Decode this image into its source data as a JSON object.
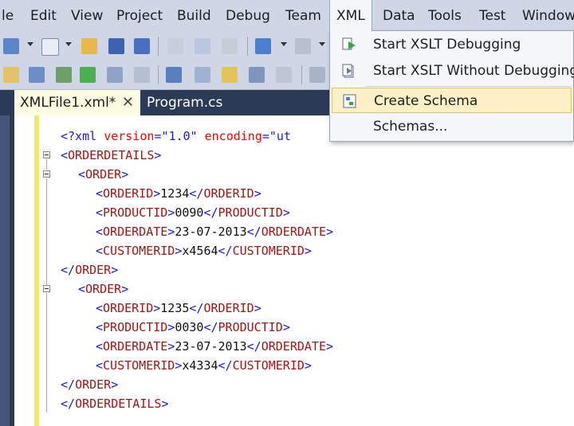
{
  "menubar": {
    "items": [
      {
        "label": "le"
      },
      {
        "label": "Edit"
      },
      {
        "label": "View"
      },
      {
        "label": "Project"
      },
      {
        "label": "Build"
      },
      {
        "label": "Debug"
      },
      {
        "label": "Team"
      },
      {
        "label": "XML"
      },
      {
        "label": "Data"
      },
      {
        "label": "Tools"
      },
      {
        "label": "Test"
      },
      {
        "label": "Window"
      }
    ]
  },
  "xml_menu": {
    "items": [
      {
        "label": "Start XSLT Debugging",
        "icon": "start-debugging-icon"
      },
      {
        "label": "Start XSLT Without Debugging",
        "icon": "start-without-debugging-icon"
      },
      {
        "label": "Create Schema",
        "icon": "create-schema-icon",
        "highlighted": true
      },
      {
        "label": "Schemas...",
        "icon": ""
      }
    ]
  },
  "tabs": [
    {
      "label": "XMLFile1.xml*",
      "active": true,
      "close": "✕"
    },
    {
      "label": "Program.cs",
      "active": false
    }
  ],
  "editor": {
    "declaration": {
      "open": "<?xml ",
      "attr1": "version",
      "eq": "=",
      "val1": "\"1.0\"",
      "attr2": "encoding",
      "val2": "\"ut"
    },
    "root_tag": "ORDERDETAILS",
    "order_tag": "ORDER",
    "orders": [
      {
        "orderid": "1234",
        "productid": "0090",
        "orderdate": "23-07-2013",
        "customerid": "x4564"
      },
      {
        "orderid": "1235",
        "productid": "0030",
        "orderdate": "23-07-2013",
        "customerid": "x4334"
      }
    ],
    "field_tags": {
      "orderid": "ORDERID",
      "productid": "PRODUCTID",
      "orderdate": "ORDERDATE",
      "customerid": "CUSTOMERID"
    }
  },
  "colors": {
    "menubar_bg": "#cfd6e5",
    "tab_strip_bg": "#2b3a55",
    "active_tab_bg": "#fdfbe0",
    "tag_color": "#a31515",
    "bracket_color": "#1b1bd8",
    "attr_color": "#ff0000",
    "highlight_bg": "#fff1c7"
  }
}
